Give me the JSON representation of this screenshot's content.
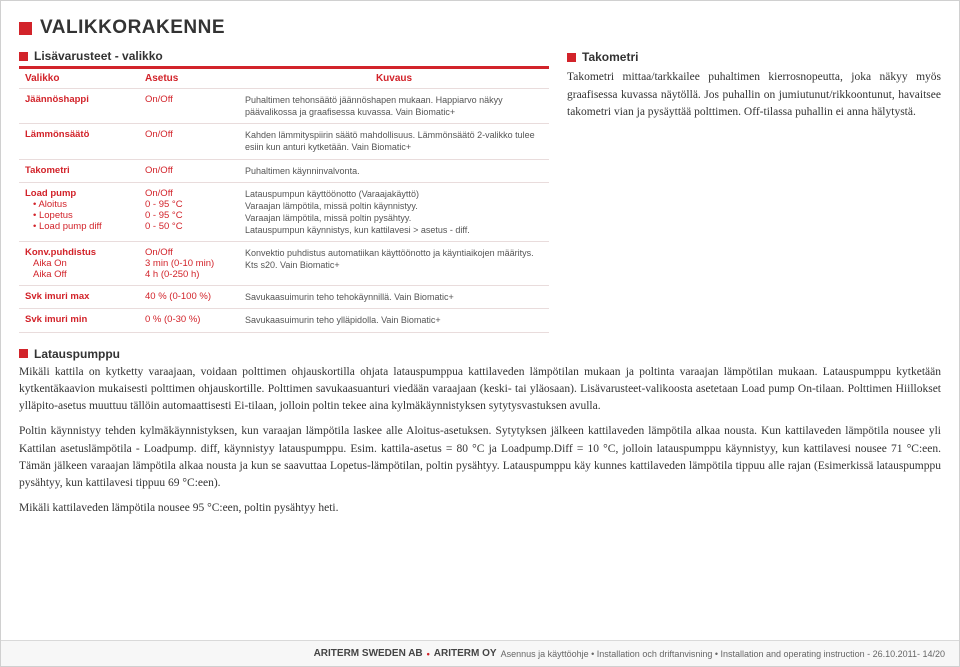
{
  "pageTitle": "VALIKKORAKENNE",
  "leftSection": {
    "heading": "Lisävarusteet - valikko",
    "columns": {
      "c1": "Valikko",
      "c2": "Asetus",
      "c3": "Kuvaus"
    },
    "rows": [
      {
        "valikko": "Jäännöshappi",
        "asetus": "On/Off",
        "kuvaus": "Puhaltimen tehonsäätö jäännöshapen mukaan. Happiarvo näkyy päävalikossa ja graafisessa kuvassa. Vain Biomatic+"
      },
      {
        "valikko": "Lämmönsäätö",
        "asetus": "On/Off",
        "kuvaus": "Kahden lämmityspiirin säätö mahdollisuus. Lämmönsäätö 2-valikko tulee esiin kun anturi kytketään. Vain Biomatic+"
      },
      {
        "valikko": "Takometri",
        "asetus": "On/Off",
        "kuvaus": "Puhaltimen käynninvalvonta."
      },
      {
        "valikko": "Load pump",
        "sub": [
          "Aloitus",
          "Lopetus",
          "Load pump diff"
        ],
        "asetus": "On/Off\n0 - 95 °C\n0 - 95 °C\n0 - 50 °C",
        "kuvaus": "Latauspumpun käyttöönotto (Varaajakäyttö)\nVaraajan lämpötila, missä poltin käynnistyy.\nVaraajan lämpötila, missä poltin pysähtyy.\nLatauspumpun käynnistys, kun kattilavesi > asetus - diff."
      },
      {
        "valikko": "Konv.puhdistus",
        "subPlain": [
          "Aika On",
          "Aika Off"
        ],
        "asetus": "On/Off\n3 min (0-10 min)\n4 h (0-250 h)",
        "kuvaus": "Konvektio puhdistus automatiikan käyttöönotto ja käyntiaikojen määritys. Kts s20. Vain Biomatic+"
      },
      {
        "valikko": "Svk imuri max",
        "asetus": "40 % (0-100 %)",
        "kuvaus": "Savukaasuimurin teho tehokäynnillä. Vain Biomatic+"
      },
      {
        "valikko": "Svk imuri min",
        "asetus": "0 % (0-30 %)",
        "kuvaus": "Savukaasuimurin teho ylläpidolla. Vain Biomatic+"
      }
    ]
  },
  "rightSection": {
    "heading": "Takometri",
    "body": "Takometri mittaa/tarkkailee puhaltimen kierrosnopeutta, joka näkyy myös graafisessa kuvassa näytöllä. Jos puhallin on jumiutunut/rikkoontunut, havaitsee takometri vian ja pysäyttää polttimen. Off-tilassa puhallin ei anna hälytystä."
  },
  "lowerSection": {
    "heading": "Latauspumppu",
    "paragraphs": [
      "Mikäli kattila on kytketty varaajaan, voidaan polttimen ohjauskortilla ohjata latauspumppua kattilaveden lämpötilan mukaan ja poltinta varaajan lämpötilan mukaan. Latauspumppu kytketään kytkentäkaavion mukaisesti polttimen ohjauskortille. Polttimen savukaasuanturi viedään varaajaan (keski- tai yläosaan). Lisävarusteet-valikoosta asetetaan Load pump On-tilaan. Polttimen Hiillokset ylläpito-asetus muuttuu tällöin automaattisesti Ei-tilaan, jolloin poltin tekee aina kylmäkäynnistyksen sytytysvastuksen avulla.",
      "Poltin käynnistyy tehden kylmäkäynnistyksen, kun varaajan lämpötila laskee alle Aloitus-asetuksen. Sytytyksen jälkeen kattilaveden lämpötila alkaa nousta. Kun kattilaveden lämpötila nousee yli Kattilan asetuslämpötila - Loadpump. diff, käynnistyy latauspumppu. Esim. kattila-asetus = 80 °C ja Loadpump.Diff = 10 °C, jolloin latauspumppu käynnistyy, kun kattilavesi nousee 71 °C:een. Tämän jälkeen varaajan lämpötila alkaa nousta ja kun se saavuttaa Lopetus-lämpötilan, poltin pysähtyy. Latauspumppu käy kunnes kattilaveden lämpötila tippuu alle rajan (Esimerkissä latauspumppu pysähtyy, kun kattilavesi tippuu 69 °C:een).",
      "Mikäli kattilaveden lämpötila nousee 95 °C:een, poltin pysähtyy heti."
    ]
  },
  "footer": {
    "brand1": "ARITERM SWEDEN AB",
    "brand2": "ARITERM OY",
    "tail": "Asennus ja käyttöohje • Installation och driftanvisning • Installation and operating instruction - 26.10.2011- 14/20"
  }
}
